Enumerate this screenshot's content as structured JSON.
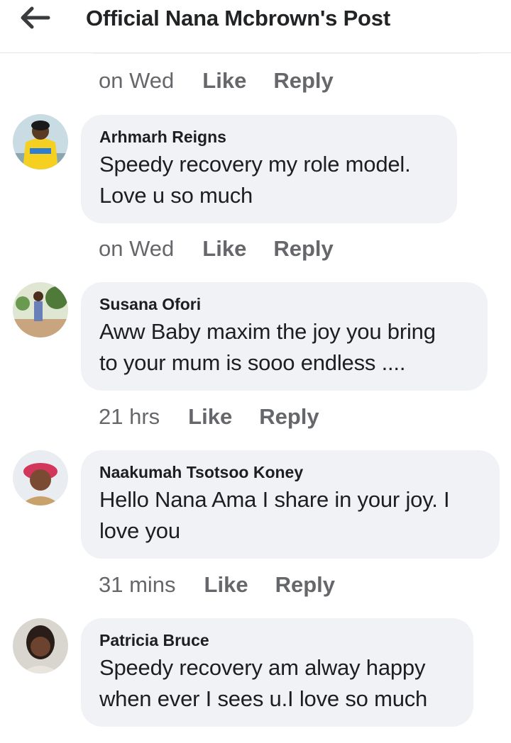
{
  "header": {
    "title": "Official Nana Mcbrown's Post",
    "back_icon": "arrow-left-icon"
  },
  "labels": {
    "like": "Like",
    "reply": "Reply"
  },
  "first_actions": {
    "time": "on Wed"
  },
  "comments": [
    {
      "author": "Arhmarh Reigns",
      "lines": [
        "Speedy recovery my role model.",
        "Love u so much"
      ],
      "time": "on Wed"
    },
    {
      "author": "Susana Ofori",
      "lines": [
        "Aww Baby maxim the joy you bring",
        "to your mum is sooo endless ...."
      ],
      "time": "21 hrs"
    },
    {
      "author": "Naakumah Tsotsoo Koney",
      "lines": [
        "Hello Nana Ama I share in your joy. I",
        "love you"
      ],
      "time": "31 mins"
    },
    {
      "author": "Patricia Bruce",
      "lines": [
        "Speedy recovery am alway happy",
        "when ever I sees u.I love so much"
      ]
    }
  ],
  "colors": {
    "bubble": "#f0f2f5",
    "secondary_text": "#65676b",
    "primary_text": "#1c1e21"
  }
}
